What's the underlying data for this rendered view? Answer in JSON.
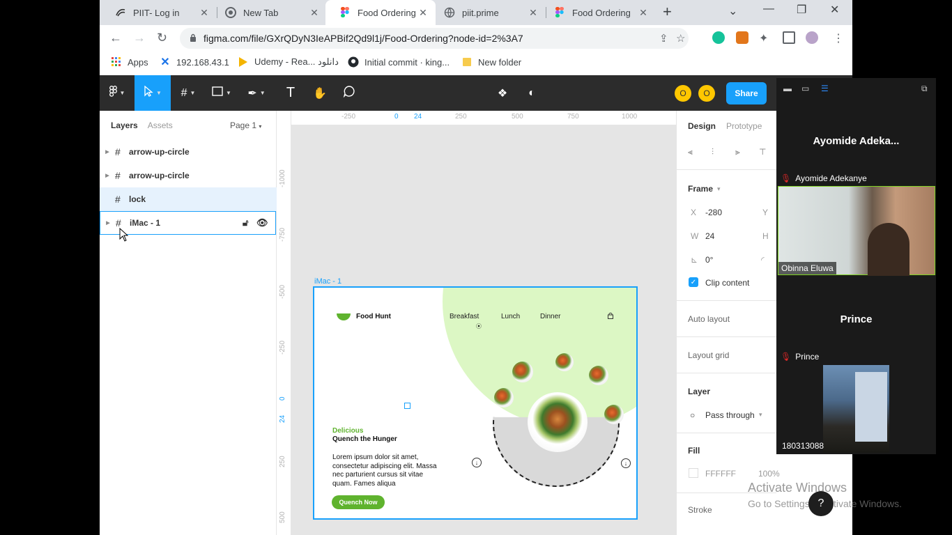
{
  "browser": {
    "tabs": [
      {
        "title": "PIIT- Log in",
        "active": false
      },
      {
        "title": "New Tab",
        "active": false
      },
      {
        "title": "Food Ordering -",
        "active": true
      },
      {
        "title": "piit.prime",
        "active": false
      },
      {
        "title": "Food Ordering",
        "active": false
      }
    ],
    "url": "figma.com/file/GXrQDyN3IeAPBif2Qd9l1j/Food-Ordering?node-id=2%3A7",
    "bookmarks": [
      {
        "label": "Apps",
        "icon": "apps-grid-icon"
      },
      {
        "label": "192.168.43.1",
        "icon": "x-icon"
      },
      {
        "label": "Udemy - Rea... دانلود",
        "icon": "bookmark-favicon-icon"
      },
      {
        "label": "Initial commit · king...",
        "icon": "github-icon"
      },
      {
        "label": "New folder",
        "icon": "folder-icon"
      }
    ]
  },
  "figma": {
    "toolbar": {
      "share_label": "Share",
      "avatars": [
        "O",
        "O"
      ],
      "accent": "#18a0fb"
    },
    "layers_panel": {
      "tab_layers": "Layers",
      "tab_assets": "Assets",
      "page": "Page 1",
      "items": [
        {
          "name": "arrow-up-circle"
        },
        {
          "name": "arrow-up-circle"
        },
        {
          "name": "lock"
        },
        {
          "name": "iMac - 1"
        }
      ]
    },
    "ruler_top": [
      "-250",
      "0",
      "24",
      "250",
      "500",
      "750",
      "1000"
    ],
    "ruler_left": [
      "-1000",
      "-750",
      "-500",
      "-250",
      "0",
      "24",
      "250",
      "500"
    ],
    "frame": {
      "label": "iMac - 1",
      "brand": "Food Hunt",
      "nav": [
        "Breakfast",
        "Lunch",
        "Dinner"
      ],
      "tagline": "Delicious",
      "headline": "Quench the Hunger",
      "body": "Lorem ipsum dolor sit amet, consectetur adipiscing elit. Massa nec parturient cursus sit vitae quam. Fames aliqua",
      "cta": "Quench Now",
      "brand_color": "#5fb32e"
    },
    "design_panel": {
      "tab_design": "Design",
      "tab_prototype": "Prototype",
      "frame_label": "Frame",
      "x_label": "X",
      "x_value": "-280",
      "y_label": "Y",
      "w_label": "W",
      "w_value": "24",
      "h_label": "H",
      "rotation": "0°",
      "clip_content": "Clip content",
      "auto_layout": "Auto layout",
      "layout_grid": "Layout grid",
      "layer_label": "Layer",
      "blend": "Pass through",
      "fill_label": "Fill",
      "fill_hex": "FFFFFF",
      "fill_opacity": "100%",
      "stroke_label": "Stroke"
    }
  },
  "zoom": {
    "participant1_header": "Ayomide Adeka...",
    "participant1_tag": "Ayomide Adekanye",
    "video1_label": "Obinna Eluwa",
    "participant2_header": "Prince",
    "participant2_tag": "Prince",
    "video2_label": "180313088"
  },
  "windows": {
    "watermark_title": "Activate Windows",
    "watermark_sub": "Go to Settings to activate Windows."
  }
}
